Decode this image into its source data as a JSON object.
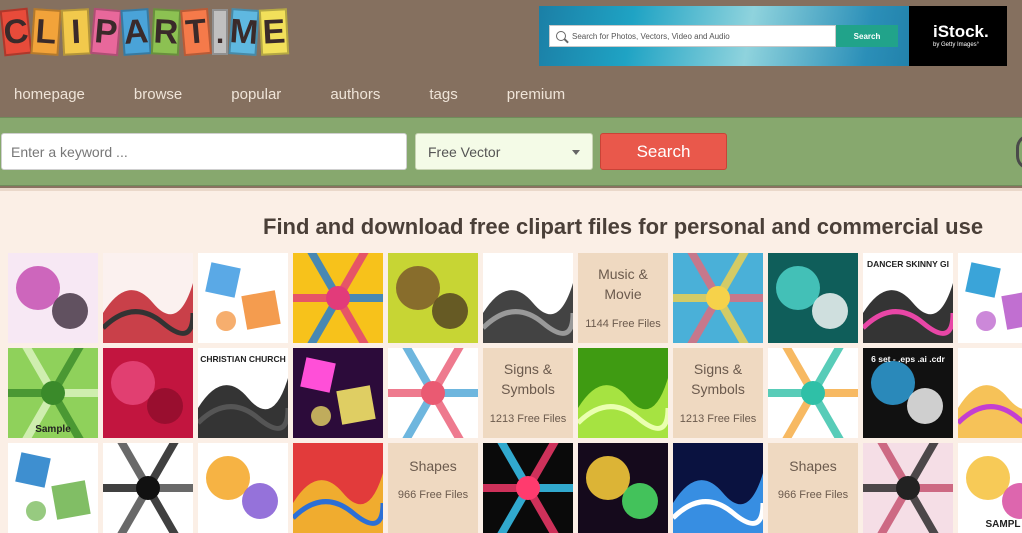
{
  "logo": {
    "letters": [
      "C",
      "L",
      "I",
      "P",
      "A",
      "R",
      "T",
      ".",
      "M",
      "E"
    ],
    "colors": [
      "#e84b3a",
      "#f2a33a",
      "#f2c94c",
      "#e8689b",
      "#4aa3d8",
      "#8cc152",
      "#f57a4a",
      "#c0c0c0",
      "#5fb8e0",
      "#f2e05a"
    ]
  },
  "ad": {
    "search_placeholder": "Search for Photos, Vectors, Video and Audio",
    "search_button": "Search",
    "brand": "iStock.",
    "brand_sub": "by Getty Images°"
  },
  "nav": {
    "items": [
      "homepage",
      "browse",
      "popular",
      "authors",
      "tags",
      "premium"
    ]
  },
  "search": {
    "placeholder": "Enter a keyword ...",
    "selected": "Free Vector",
    "button": "Search"
  },
  "tagline": "Find and download free clipart files for personal and commercial use",
  "tiles": [
    {
      "kind": "img",
      "name": "film-strip-thumbnail",
      "colors": [
        "#f7e8f4",
        "#c64fb1",
        "#3b2b3b"
      ]
    },
    {
      "kind": "img",
      "name": "speaker-music-thumbnail",
      "colors": [
        "#fbf1ef",
        "#c0212b",
        "#333333"
      ]
    },
    {
      "kind": "img",
      "name": "colorful-icons-thumbnail",
      "colors": [
        "#ffffff",
        "#5aa9e6",
        "#f28b30"
      ]
    },
    {
      "kind": "img",
      "name": "music-abstract-thumbnail",
      "colors": [
        "#f7c21b",
        "#e23b7a",
        "#1d7ad8"
      ]
    },
    {
      "kind": "img",
      "name": "cassette-remix-thumbnail",
      "colors": [
        "#c7d534",
        "#7d5a2c",
        "#4e3b20"
      ]
    },
    {
      "kind": "img",
      "name": "music-notes-thumbnail",
      "colors": [
        "#ffffff",
        "#222222",
        "#999999"
      ]
    },
    {
      "kind": "text",
      "title": [
        "Music &",
        "Movie"
      ],
      "count": "1144 Free Files"
    },
    {
      "kind": "img",
      "name": "beach-girls-thumbnail",
      "colors": [
        "#4ab0d8",
        "#f6d24a",
        "#e56b7a"
      ]
    },
    {
      "kind": "img",
      "name": "teal-wave-thumbnail",
      "colors": [
        "#0f5e5a",
        "#4cd1c8",
        "#ffffff"
      ]
    },
    {
      "kind": "img",
      "name": "dancer-silhouettes-thumbnail",
      "text": "DANCER SKINNY GI",
      "colors": [
        "#ffffff",
        "#111111",
        "#e846a6"
      ]
    },
    {
      "kind": "img",
      "name": "circles-abstract-thumbnail",
      "colors": [
        "#ffffff",
        "#3aa4d9",
        "#b656c9"
      ]
    },
    {
      "kind": "img",
      "name": "green-sample-thumbnail",
      "text": "Sample",
      "colors": [
        "#8fd15b",
        "#3a8a2a",
        "#e0f6c4"
      ]
    },
    {
      "kind": "img",
      "name": "red-pattern-thumbnail",
      "colors": [
        "#c2153f",
        "#e6477a",
        "#8e0d2c"
      ]
    },
    {
      "kind": "img",
      "name": "christian-church-thumbnail",
      "text": "CHRISTIAN CHURCH",
      "colors": [
        "#ffffff",
        "#111111",
        "#555555"
      ]
    },
    {
      "kind": "img",
      "name": "burst-lights-thumbnail",
      "colors": [
        "#2c0b3a",
        "#ff4fd8",
        "#fff16b"
      ]
    },
    {
      "kind": "img",
      "name": "city-buildings-thumbnail",
      "colors": [
        "#ffffff",
        "#ea5a72",
        "#4aa5d6"
      ]
    },
    {
      "kind": "text",
      "title": [
        "Signs &",
        "Symbols"
      ],
      "count": "1213 Free Files"
    },
    {
      "kind": "img",
      "name": "green-leaves-thumbnail",
      "colors": [
        "#3f9b12",
        "#b9f04a",
        "#eaffb0"
      ]
    },
    {
      "kind": "text",
      "title": [
        "Signs &",
        "Symbols"
      ],
      "count": "1213 Free Files"
    },
    {
      "kind": "img",
      "name": "flower-heart-thumbnail",
      "colors": [
        "#ffffff",
        "#2fc0a7",
        "#f6a83b"
      ]
    },
    {
      "kind": "img",
      "name": "twitter-birds-thumbnail",
      "text": "6 set - .eps .ai .cdr",
      "colors": [
        "#111111",
        "#2f9fd8",
        "#ffffff"
      ]
    },
    {
      "kind": "img",
      "name": "rainbow-swirl-thumbnail",
      "colors": [
        "#ffffff",
        "#f5b73b",
        "#c43fd1"
      ]
    },
    {
      "kind": "img",
      "name": "business-logos-thumbnail",
      "colors": [
        "#ffffff",
        "#3e8fd0",
        "#6bb34a"
      ]
    },
    {
      "kind": "img",
      "name": "black-icons-thumbnail",
      "colors": [
        "#ffffff",
        "#111111",
        "#444444"
      ]
    },
    {
      "kind": "img",
      "name": "geometric-colors-thumbnail",
      "colors": [
        "#ffffff",
        "#f5a623",
        "#7b4fd1"
      ]
    },
    {
      "kind": "img",
      "name": "polygon-mosaic-thumbnail",
      "colors": [
        "#e23b3b",
        "#f2c12e",
        "#2b6fd6"
      ]
    },
    {
      "kind": "text",
      "title": [
        "Shapes"
      ],
      "count": "966 Free Files"
    },
    {
      "kind": "img",
      "name": "light-streaks-thumbnail",
      "colors": [
        "#0a0a0a",
        "#ff3b6e",
        "#3bd1ff"
      ]
    },
    {
      "kind": "img",
      "name": "bokeh-rings-thumbnail",
      "colors": [
        "#150a1c",
        "#ffd23b",
        "#4ff06b"
      ]
    },
    {
      "kind": "img",
      "name": "blue-rays-thumbnail",
      "colors": [
        "#0a1240",
        "#3fa5ff",
        "#ffffff"
      ]
    },
    {
      "kind": "text",
      "title": [
        "Shapes"
      ],
      "count": "966 Free Files"
    },
    {
      "kind": "img",
      "name": "arrows-pattern-thumbnail",
      "colors": [
        "#f5dee6",
        "#222222",
        "#c44d6b"
      ]
    },
    {
      "kind": "img",
      "name": "sample-wave-thumbnail",
      "text": "SAMPL",
      "colors": [
        "#ffffff",
        "#f6c13a",
        "#d4409a"
      ]
    }
  ]
}
